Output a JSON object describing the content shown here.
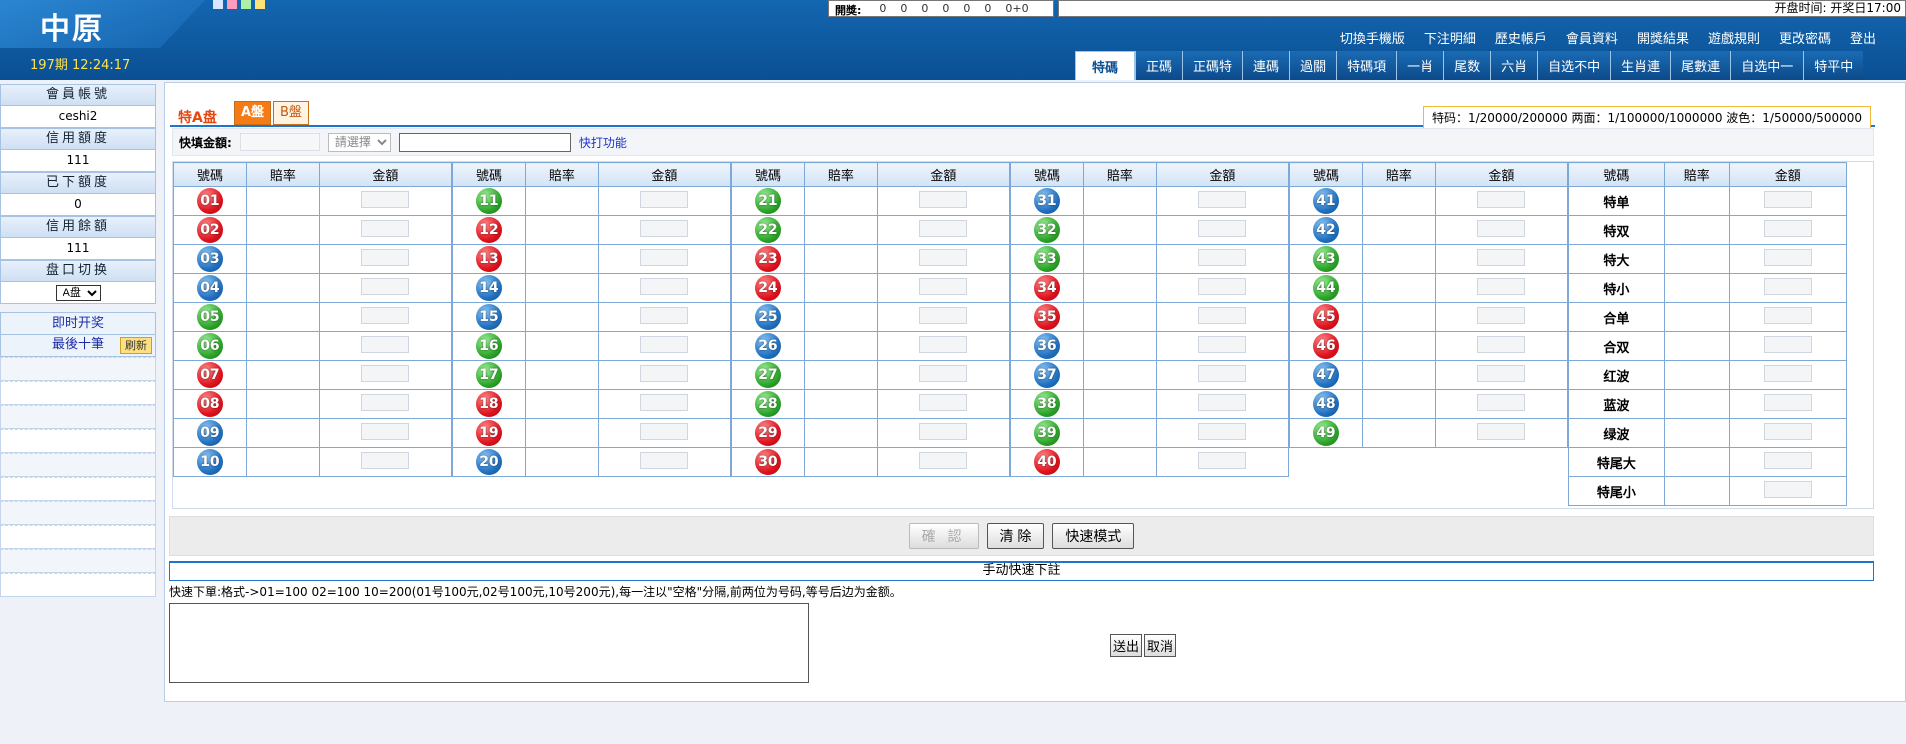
{
  "header": {
    "logo": "中原",
    "period": "197期 12:24:17",
    "result_label": "開獎:",
    "result_digits": [
      "0",
      "0",
      "0",
      "0",
      "0",
      "0",
      "0+0"
    ],
    "open_time": "开盘时间: 开奖日17:00",
    "squares": [
      "#d8e7ff",
      "#ff9bbf",
      "#aef0a6",
      "#ffe27a"
    ]
  },
  "topnav": [
    "切換手機版",
    "下注明細",
    "歷史帳戶",
    "會員資料",
    "開獎結果",
    "遊戲規則",
    "更改密碼",
    "登出"
  ],
  "tabs": [
    "特碼",
    "正碼",
    "正碼特",
    "連碼",
    "過關",
    "特碼項",
    "一肖",
    "尾数",
    "六肖",
    "自选不中",
    "生肖連",
    "尾數連",
    "自选中一",
    "特平中"
  ],
  "sidebar": {
    "account_label": "會員帳號",
    "account": "ceshi2",
    "credit_label": "信用額度",
    "credit": "111",
    "used_label": "已下額度",
    "used": "0",
    "balance_label": "信用餘額",
    "balance": "111",
    "switch_label": "盘口切换",
    "switch_value": "A盘",
    "live_link": "即时开奖",
    "last10_label": "最後十筆",
    "refresh_button": "刷新"
  },
  "plate": {
    "title": "特A盘",
    "a": "A盤",
    "b": "B盤",
    "limits": "特码：1/20000/200000 两面：1/100000/1000000 波色：1/50000/500000"
  },
  "quick": {
    "label": "快填金額:",
    "select": "請選擇",
    "link": "快打功能"
  },
  "grid": {
    "headers": [
      "號碼",
      "賠率",
      "金額"
    ],
    "columns": [
      [
        {
          "n": "01",
          "c": "red"
        },
        {
          "n": "02",
          "c": "red"
        },
        {
          "n": "03",
          "c": "blue"
        },
        {
          "n": "04",
          "c": "blue"
        },
        {
          "n": "05",
          "c": "green"
        },
        {
          "n": "06",
          "c": "green"
        },
        {
          "n": "07",
          "c": "red"
        },
        {
          "n": "08",
          "c": "red"
        },
        {
          "n": "09",
          "c": "blue"
        },
        {
          "n": "10",
          "c": "blue"
        }
      ],
      [
        {
          "n": "11",
          "c": "green"
        },
        {
          "n": "12",
          "c": "red"
        },
        {
          "n": "13",
          "c": "red"
        },
        {
          "n": "14",
          "c": "blue"
        },
        {
          "n": "15",
          "c": "blue"
        },
        {
          "n": "16",
          "c": "green"
        },
        {
          "n": "17",
          "c": "green"
        },
        {
          "n": "18",
          "c": "red"
        },
        {
          "n": "19",
          "c": "red"
        },
        {
          "n": "20",
          "c": "blue"
        }
      ],
      [
        {
          "n": "21",
          "c": "green"
        },
        {
          "n": "22",
          "c": "green"
        },
        {
          "n": "23",
          "c": "red"
        },
        {
          "n": "24",
          "c": "red"
        },
        {
          "n": "25",
          "c": "blue"
        },
        {
          "n": "26",
          "c": "blue"
        },
        {
          "n": "27",
          "c": "green"
        },
        {
          "n": "28",
          "c": "green"
        },
        {
          "n": "29",
          "c": "red"
        },
        {
          "n": "30",
          "c": "red"
        }
      ],
      [
        {
          "n": "31",
          "c": "blue"
        },
        {
          "n": "32",
          "c": "green"
        },
        {
          "n": "33",
          "c": "green"
        },
        {
          "n": "34",
          "c": "red"
        },
        {
          "n": "35",
          "c": "red"
        },
        {
          "n": "36",
          "c": "blue"
        },
        {
          "n": "37",
          "c": "blue"
        },
        {
          "n": "38",
          "c": "green"
        },
        {
          "n": "39",
          "c": "green"
        },
        {
          "n": "40",
          "c": "red"
        }
      ],
      [
        {
          "n": "41",
          "c": "blue"
        },
        {
          "n": "42",
          "c": "blue"
        },
        {
          "n": "43",
          "c": "green"
        },
        {
          "n": "44",
          "c": "green"
        },
        {
          "n": "45",
          "c": "red"
        },
        {
          "n": "46",
          "c": "red"
        },
        {
          "n": "47",
          "c": "blue"
        },
        {
          "n": "48",
          "c": "blue"
        },
        {
          "n": "49",
          "c": "green"
        }
      ]
    ],
    "options": [
      "特单",
      "特双",
      "特大",
      "特小",
      "合单",
      "合双",
      "红波",
      "蓝波",
      "绿波",
      "特尾大",
      "特尾小"
    ]
  },
  "buttons": {
    "confirm": "確 認",
    "clear": "清 除",
    "fast": "快速模式"
  },
  "manual": {
    "title": "手动快速下註",
    "desc": "快速下單:格式->01=100 02=100 10=200(01号100元,02号100元,10号200元),每一注以\"空格\"分隔,前两位为号码,等号后边为金额。",
    "send": "送出",
    "cancel": "取消"
  }
}
